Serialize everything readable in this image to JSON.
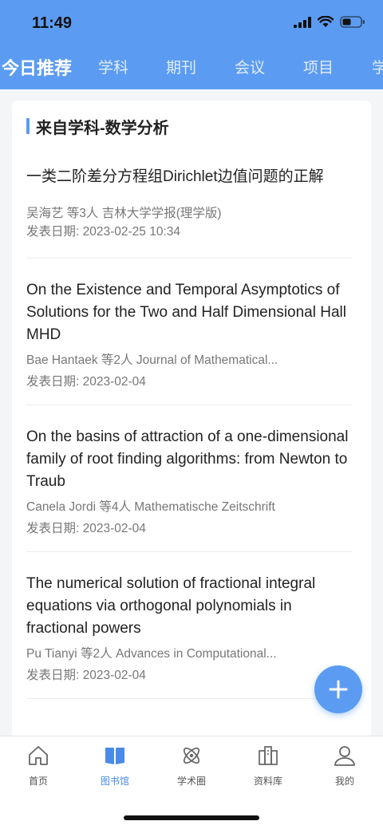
{
  "status": {
    "time": "11:49"
  },
  "tabs": [
    {
      "label": "今日推荐",
      "active": true
    },
    {
      "label": "学科"
    },
    {
      "label": "期刊"
    },
    {
      "label": "会议"
    },
    {
      "label": "项目"
    },
    {
      "label": "学"
    }
  ],
  "section": {
    "title": "来自学科-数学分析"
  },
  "articles": [
    {
      "title": "一类二阶差分方程组Dirichlet边值问题的正解",
      "meta": "吴海艺 等3人  吉林大学学报(理学版)",
      "date": "发表日期: 2023-02-25 10:34"
    },
    {
      "title": "On the Existence and Temporal Asymptotics of Solutions for the Two and Half Dimensional Hall MHD",
      "meta": "Bae Hantaek 等2人  Journal of Mathematical...",
      "date": "发表日期: 2023-02-04"
    },
    {
      "title": "On the basins of attraction of a one-dimensional family of root finding algorithms: from Newton to Traub",
      "meta": "Canela Jordi 等4人  Mathematische Zeitschrift",
      "date": "发表日期: 2023-02-04"
    },
    {
      "title": "The numerical solution of fractional integral equations via orthogonal polynomials in fractional powers",
      "meta": "Pu Tianyi 等2人  Advances in Computational...",
      "date": "发表日期: 2023-02-04"
    }
  ],
  "fab": {
    "icon": "plus-icon",
    "color": "#5b9cf2"
  },
  "tabbar": [
    {
      "label": "首页",
      "icon": "home-icon"
    },
    {
      "label": "图书馆",
      "icon": "book-icon",
      "active": true
    },
    {
      "label": "学术圈",
      "icon": "atom-icon"
    },
    {
      "label": "资料库",
      "icon": "library-icon"
    },
    {
      "label": "我的",
      "icon": "person-icon"
    }
  ],
  "colors": {
    "accent": "#5b9cf2",
    "active_tab": "#4a8ae8"
  }
}
